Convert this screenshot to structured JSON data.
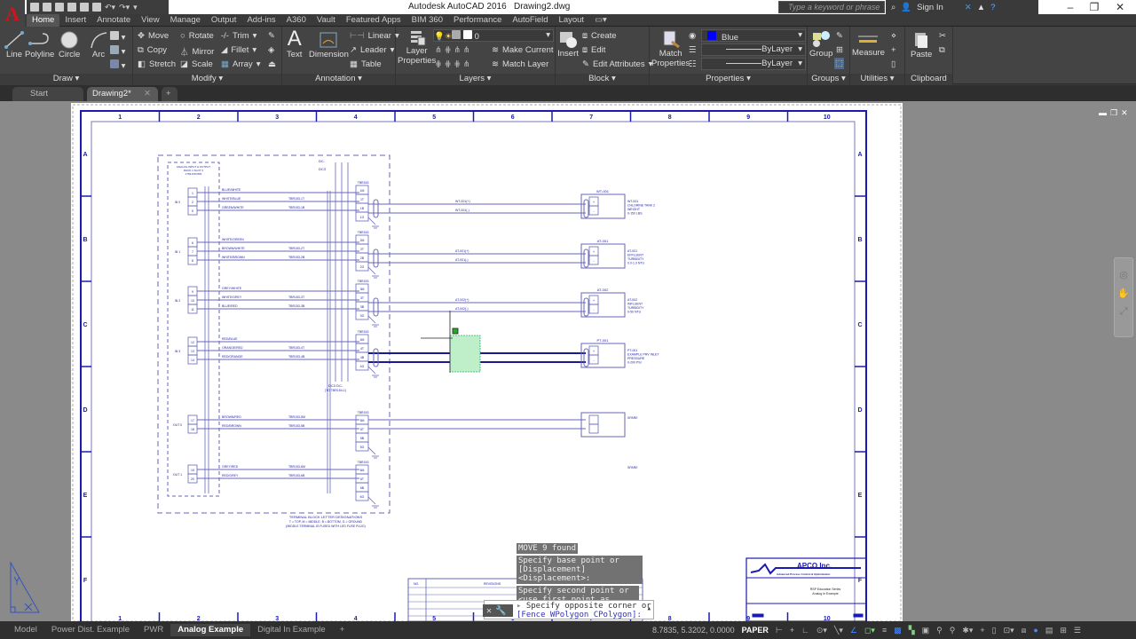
{
  "window": {
    "app_title": "Autodesk AutoCAD 2016",
    "file_name": "Drawing2.dwg",
    "search_placeholder": "Type a keyword or phrase",
    "sign_in": "Sign In"
  },
  "ribbon_tabs": [
    "Home",
    "Insert",
    "Annotate",
    "View",
    "Manage",
    "Output",
    "Add-ins",
    "A360",
    "Vault",
    "Featured Apps",
    "BIM 360",
    "Performance",
    "AutoField",
    "Layout"
  ],
  "active_ribbon_tab": "Home",
  "ribbon": {
    "draw": {
      "title": "Draw",
      "line": "Line",
      "polyline": "Polyline",
      "circle": "Circle",
      "arc": "Arc"
    },
    "modify": {
      "title": "Modify",
      "move": "Move",
      "rotate": "Rotate",
      "trim": "Trim",
      "copy": "Copy",
      "mirror": "Mirror",
      "fillet": "Fillet",
      "stretch": "Stretch",
      "scale": "Scale",
      "array": "Array"
    },
    "annotation": {
      "title": "Annotation",
      "text": "Text",
      "dimension": "Dimension",
      "linear": "Linear",
      "leader": "Leader",
      "table": "Table"
    },
    "layers": {
      "title": "Layers",
      "layer_properties_1": "Layer",
      "layer_properties_2": "Properties",
      "current_layer": "0",
      "make_current": "Make Current",
      "match_layer": "Match Layer"
    },
    "block": {
      "title": "Block",
      "insert": "Insert",
      "create": "Create",
      "edit": "Edit",
      "edit_attributes": "Edit Attributes"
    },
    "properties": {
      "title": "Properties",
      "match_1": "Match",
      "match_2": "Properties",
      "color": "Blue",
      "color_hex": "#0000ff",
      "linetype": "ByLayer",
      "lineweight": "ByLayer"
    },
    "groups": {
      "title": "Groups",
      "group": "Group"
    },
    "utilities": {
      "title": "Utilities",
      "measure": "Measure"
    },
    "clipboard": {
      "title": "Clipboard",
      "paste": "Paste"
    }
  },
  "doc_tabs": [
    {
      "label": "Start"
    },
    {
      "label": "Drawing2*"
    }
  ],
  "drawing": {
    "col_labels": [
      "1",
      "2",
      "3",
      "4",
      "5",
      "6",
      "7",
      "8",
      "9",
      "10"
    ],
    "row_labels": [
      "A",
      "B",
      "C",
      "D",
      "E",
      "F"
    ],
    "module_title": [
      "ANALOG INPUT & OUTPUT",
      "RACK 1 SLOT 3",
      "1756-IF8 M02"
    ],
    "inputs": [
      {
        "group": "IN 0",
        "terminals": [
          "1",
          "2",
          "5"
        ],
        "wires": [
          "BLUE/WHITE",
          "WHITE/BLUE",
          "GREEN/WHITE"
        ],
        "tags": [
          "TBR153-1T",
          "TBR153-1B"
        ],
        "tb": "TBR153",
        "tb_pins": [
          "1M",
          "1T",
          "1B",
          "1G"
        ],
        "signals": [
          "WT-001(+)",
          "WT-001(-)"
        ],
        "device": "WT-001",
        "desc": [
          "WT-001",
          "CHLORINE TANK 2",
          "WEIGHT",
          "0-150 LBS"
        ]
      },
      {
        "group": "IN 1",
        "terminals": [
          "6",
          "7",
          "8"
        ],
        "wires": [
          "WHITE/GREEN",
          "BROWN/WHITE",
          "WHITE/BROWN"
        ],
        "tags": [
          "TBR153-2T",
          "TBR153-2B"
        ],
        "tb": "TBR153",
        "tb_pins": [
          "2M",
          "2T",
          "2B",
          "2G"
        ],
        "signals": [
          "AT-001(+)",
          "AT-001(-)"
        ],
        "device": "AT-001",
        "desc": [
          "AT-001",
          "EFFLUENT",
          "TURBIDITY",
          "0.0-1.0 NTU"
        ]
      },
      {
        "group": "IN 2",
        "terminals": [
          "9",
          "10",
          "11"
        ],
        "wires": [
          "GREY/WHITE",
          "WHITE/GREY",
          "BLUE/RED"
        ],
        "tags": [
          "TBR153-3T",
          "TBR153-3B"
        ],
        "tb": "TBR153",
        "tb_pins": [
          "3M",
          "3T",
          "3B",
          "3G"
        ],
        "signals": [
          "AT-002(+)",
          "AT-002(-)"
        ],
        "device": "AT-002",
        "desc": [
          "AT-002",
          "INFLUENT",
          "TURBIDITY",
          "0-50 NTU"
        ]
      },
      {
        "group": "IN 3",
        "terminals": [
          "12",
          "13",
          "14"
        ],
        "wires": [
          "RED/BLUE",
          "ORANGE/RED",
          "RED/ORANGE"
        ],
        "tags": [
          "TBR153-4T",
          "TBR153-4B"
        ],
        "tb": "TBR153",
        "tb_pins": [
          "4M",
          "4T",
          "4B",
          "4G"
        ],
        "signals": [
          "PT-001(+)",
          "PT-001(-)"
        ],
        "device": "PT-001",
        "desc": [
          "PT-001",
          "EXAMPLE PRV INLET",
          "PRESSURE",
          "0-200 PSI"
        ]
      }
    ],
    "outputs": [
      {
        "group": "OUT 0",
        "terminals": [
          "17",
          "18"
        ],
        "wires": [
          "BROWN/RED",
          "RED/BROWN"
        ],
        "tags": [
          "TBR153-5M",
          "TBR153-5B"
        ],
        "tb": "TBR153",
        "tb_pins": [
          "5M",
          "5T",
          "5B",
          "5G"
        ],
        "device_desc": "SPARE"
      },
      {
        "group": "OUT 1",
        "terminals": [
          "19",
          "20"
        ],
        "wires": [
          "GREY/RED",
          "RED/GREY"
        ],
        "tags": [
          "TBR153-6M",
          "TBR153-6B"
        ],
        "tb": "TBR153",
        "tb_pins": [
          "6M",
          "6T",
          "6B",
          "6G"
        ],
        "device_desc": "SPARE"
      }
    ],
    "dc_labels": [
      "DC-",
      "DC3"
    ],
    "dc_bottom": [
      "DC3",
      "DC-",
      "(TO TBR154-1)"
    ],
    "legend": [
      "TERMINAL BLOCK LETTER DESIGNATIONS",
      "T = TOP, M = MIDDLE, B = BOTTOM, G = GROUND",
      "(MIDDLE TERMINAL IS FUSED WITH LED FUSE PLUG)"
    ],
    "revisions_header": {
      "no": "NO.",
      "revisions": "REVISIONS"
    },
    "title_block": {
      "company": "APCO Inc.",
      "tagline": "Advanced Process Control & Optimization",
      "line1": "RSP Education Series",
      "line2": "Analog In Example"
    }
  },
  "command": {
    "history": [
      "MOVE 9 found",
      "Specify base point or [Displacement] <Displacement>:",
      "Specify second point or <use first point as displacement>:"
    ],
    "prompt": "Specify opposite corner or",
    "options": "[Fence WPolygon CPolygon]:"
  },
  "layout_tabs": [
    "Model",
    "Power Dist. Example",
    "PWR",
    "Analog Example",
    "Digital In Example"
  ],
  "active_layout": "Analog Example",
  "status": {
    "coords": "8.7835, 5.3202, 0.0000",
    "space": "PAPER"
  }
}
